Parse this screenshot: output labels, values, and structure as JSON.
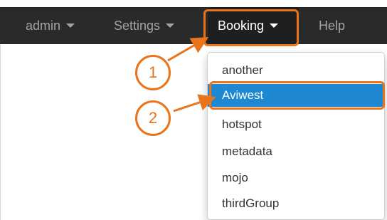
{
  "navbar": {
    "items": [
      {
        "label": "admin",
        "has_caret": true
      },
      {
        "label": "Settings",
        "has_caret": true
      },
      {
        "label": "Booking",
        "has_caret": true,
        "active": true
      },
      {
        "label": "Help",
        "has_caret": false
      }
    ]
  },
  "dropdown": {
    "items": [
      {
        "label": "another"
      },
      {
        "label": "Aviwest",
        "selected": true
      },
      {
        "label": "hotspot"
      },
      {
        "label": "metadata"
      },
      {
        "label": "mojo"
      },
      {
        "label": "thirdGroup"
      }
    ]
  },
  "annotations": {
    "step1": "1",
    "step2": "2"
  },
  "colors": {
    "navbar_bg": "#2a2a2a",
    "accent_orange": "#e8741c",
    "selection_blue": "#1e88d2"
  }
}
